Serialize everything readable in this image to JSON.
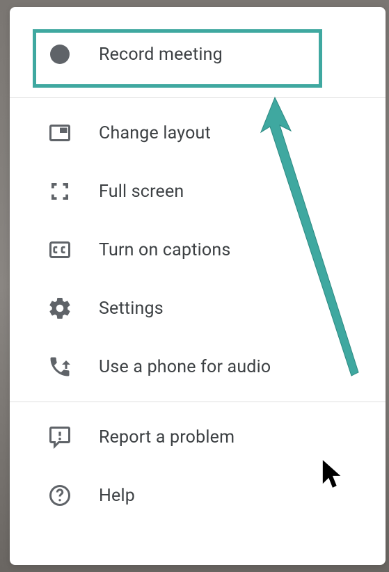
{
  "menu": {
    "record": {
      "label": "Record meeting"
    },
    "changeLayout": {
      "label": "Change layout"
    },
    "fullScreen": {
      "label": "Full screen"
    },
    "captions": {
      "label": "Turn on captions"
    },
    "settings": {
      "label": "Settings"
    },
    "phoneAudio": {
      "label": "Use a phone for audio"
    },
    "reportProblem": {
      "label": "Report a problem"
    },
    "help": {
      "label": "Help"
    }
  },
  "colors": {
    "highlight": "#3fa8a0",
    "icon": "#5f6368",
    "text": "#3c4043"
  }
}
